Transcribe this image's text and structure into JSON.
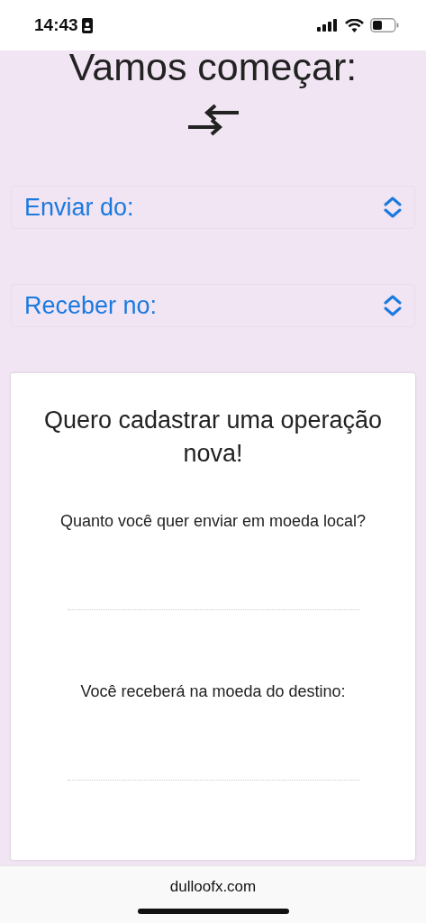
{
  "status_bar": {
    "time": "14:43"
  },
  "heading": "Vamos começar:",
  "selects": [
    {
      "label": "Enviar do:"
    },
    {
      "label": "Receber no:"
    }
  ],
  "card": {
    "title": "Quero cadastrar uma operação nova!",
    "fields": [
      {
        "label": "Quanto você quer enviar em moeda local?"
      },
      {
        "label": "Você receberá na moeda do destino:"
      }
    ]
  },
  "browser_bar": {
    "url": "dulloofx.com"
  }
}
